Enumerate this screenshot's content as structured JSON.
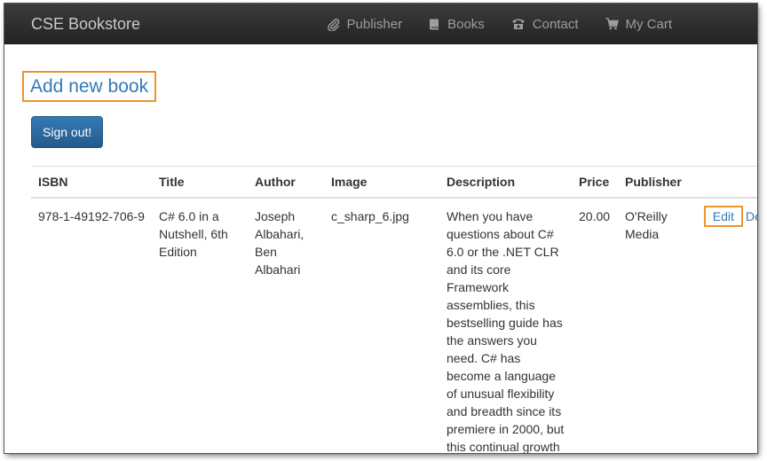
{
  "navbar": {
    "brand": "CSE Bookstore",
    "items": [
      {
        "icon": "paperclip-icon",
        "label": "Publisher"
      },
      {
        "icon": "book-icon",
        "label": "Books"
      },
      {
        "icon": "phone-icon",
        "label": "Contact"
      },
      {
        "icon": "cart-icon",
        "label": "My Cart"
      }
    ]
  },
  "main": {
    "add_book_link": "Add new book",
    "signout_label": "Sign out!"
  },
  "table": {
    "headers": [
      "ISBN",
      "Title",
      "Author",
      "Image",
      "Description",
      "Price",
      "Publisher"
    ],
    "rows": [
      {
        "isbn": "978-1-49192-706-9",
        "title": "C# 6.0 in a Nutshell, 6th Edition",
        "author": "Joseph Albahari, Ben Albahari",
        "image": "c_sharp_6.jpg",
        "description": "When you have questions about C# 6.0 or the .NET CLR and its core Framework assemblies, this bestselling guide has the answers you need. C# has become a language of unusual flexibility and breadth since its premiere in 2000, but this continual growth",
        "price": "20.00",
        "publisher": "O'Reilly Media",
        "edit_label": "Edit",
        "delete_label": "Delete"
      }
    ]
  }
}
